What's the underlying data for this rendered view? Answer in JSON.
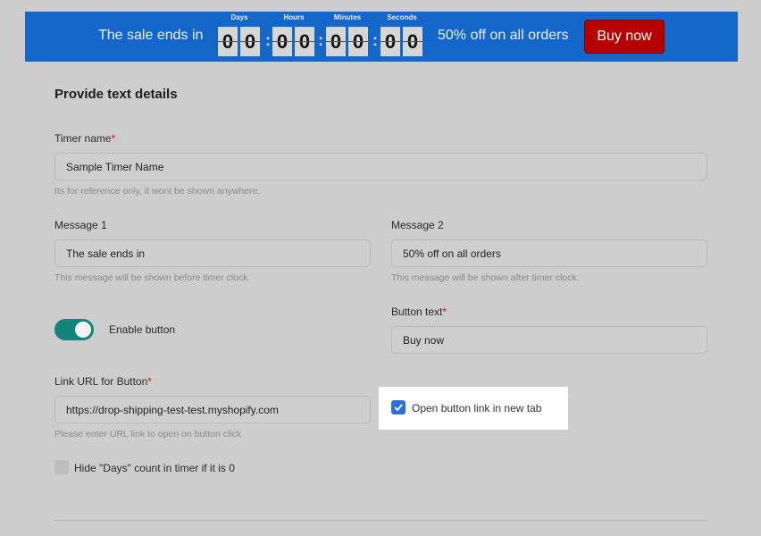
{
  "banner": {
    "message1": "The sale ends in",
    "message2": "50% off on all orders",
    "button_label": "Buy now",
    "timer": {
      "days": {
        "label": "Days",
        "d1": "0",
        "d2": "0"
      },
      "hours": {
        "label": "Hours",
        "d1": "0",
        "d2": "0"
      },
      "minutes": {
        "label": "Minutes",
        "d1": "0",
        "d2": "0"
      },
      "seconds": {
        "label": "Seconds",
        "d1": "0",
        "d2": "0"
      },
      "separator": ":"
    },
    "colors": {
      "background": "#1466c9",
      "button": "#b70000"
    }
  },
  "form": {
    "heading": "Provide text details",
    "required_mark": "*",
    "timer_name": {
      "label": "Timer name",
      "value": "Sample Timer Name",
      "help": "Its for reference only, it wont be shown anywhere."
    },
    "message1": {
      "label": "Message 1",
      "value": "The sale ends in",
      "help": "This message will be shown before timer clock"
    },
    "message2": {
      "label": "Message 2",
      "value": "50% off on all orders",
      "help": "This message will be shown after timer clock."
    },
    "enable_button": {
      "label": "Enable button",
      "checked": true
    },
    "button_text": {
      "label": "Button text",
      "value": "Buy now"
    },
    "link_url": {
      "label": "Link URL for Button",
      "value": "https://drop-shipping-test-test.myshopify.com",
      "help": "Please enter URL link to open on button click"
    },
    "open_new_tab": {
      "label": "Open button link in new tab",
      "checked": true
    },
    "hide_days": {
      "label": "Hide \"Days\" count in timer if it is 0",
      "checked": false
    }
  },
  "colors": {
    "page_bg": "#cdcdcd",
    "toggle": "#12857a",
    "checkbox": "#2f6fd8",
    "required": "#dd1111"
  }
}
